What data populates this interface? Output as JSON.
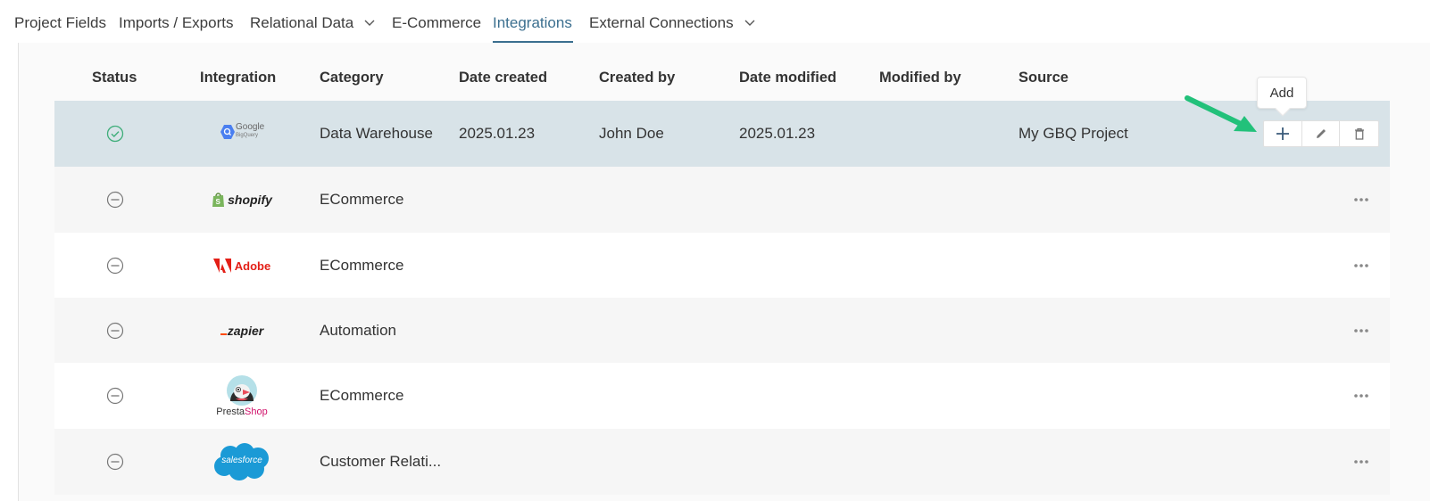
{
  "tabs": [
    {
      "label": "Project Fields",
      "dropdown": false,
      "active": false
    },
    {
      "label": "Imports / Exports",
      "dropdown": false,
      "active": false
    },
    {
      "label": "Relational Data",
      "dropdown": true,
      "active": false
    },
    {
      "label": "E-Commerce",
      "dropdown": false,
      "active": false
    },
    {
      "label": "Integrations",
      "dropdown": false,
      "active": true
    },
    {
      "label": "External Connections",
      "dropdown": true,
      "active": false
    }
  ],
  "table": {
    "columns": [
      "Status",
      "Integration",
      "Category",
      "Date created",
      "Created by",
      "Date modified",
      "Modified by",
      "Source"
    ],
    "rows": [
      {
        "status": "active",
        "integration": "Google BigQuery",
        "logo_text": {
          "main": "Google",
          "sub": "BigQuery"
        },
        "category": "Data Warehouse",
        "date_created": "2025.01.23",
        "created_by": "John Doe",
        "date_modified": "2025.01.23",
        "modified_by": "",
        "source": "My GBQ Project"
      },
      {
        "status": "inactive",
        "integration": "Shopify",
        "logo_text": {
          "main": "shopify"
        },
        "category": "ECommerce",
        "date_created": "",
        "created_by": "",
        "date_modified": "",
        "modified_by": "",
        "source": ""
      },
      {
        "status": "inactive",
        "integration": "Adobe",
        "logo_text": {
          "main": "Adobe"
        },
        "category": "ECommerce",
        "date_created": "",
        "created_by": "",
        "date_modified": "",
        "modified_by": "",
        "source": ""
      },
      {
        "status": "inactive",
        "integration": "Zapier",
        "logo_text": {
          "main": "zapier"
        },
        "category": "Automation",
        "date_created": "",
        "created_by": "",
        "date_modified": "",
        "modified_by": "",
        "source": ""
      },
      {
        "status": "inactive",
        "integration": "PrestaShop",
        "logo_text": {
          "main": "Presta",
          "sub": "Shop"
        },
        "category": "ECommerce",
        "date_created": "",
        "created_by": "",
        "date_modified": "",
        "modified_by": "",
        "source": ""
      },
      {
        "status": "inactive",
        "integration": "Salesforce",
        "logo_text": {
          "main": "salesforce"
        },
        "category": "Customer Relati...",
        "date_created": "",
        "created_by": "",
        "date_modified": "",
        "modified_by": "",
        "source": ""
      }
    ]
  },
  "tooltip": {
    "label": "Add"
  },
  "colors": {
    "accent": "#3b6f8f",
    "selected_row": "#d8e3e8",
    "status_active": "#3fae7a",
    "annotation_arrow": "#22c17a"
  }
}
